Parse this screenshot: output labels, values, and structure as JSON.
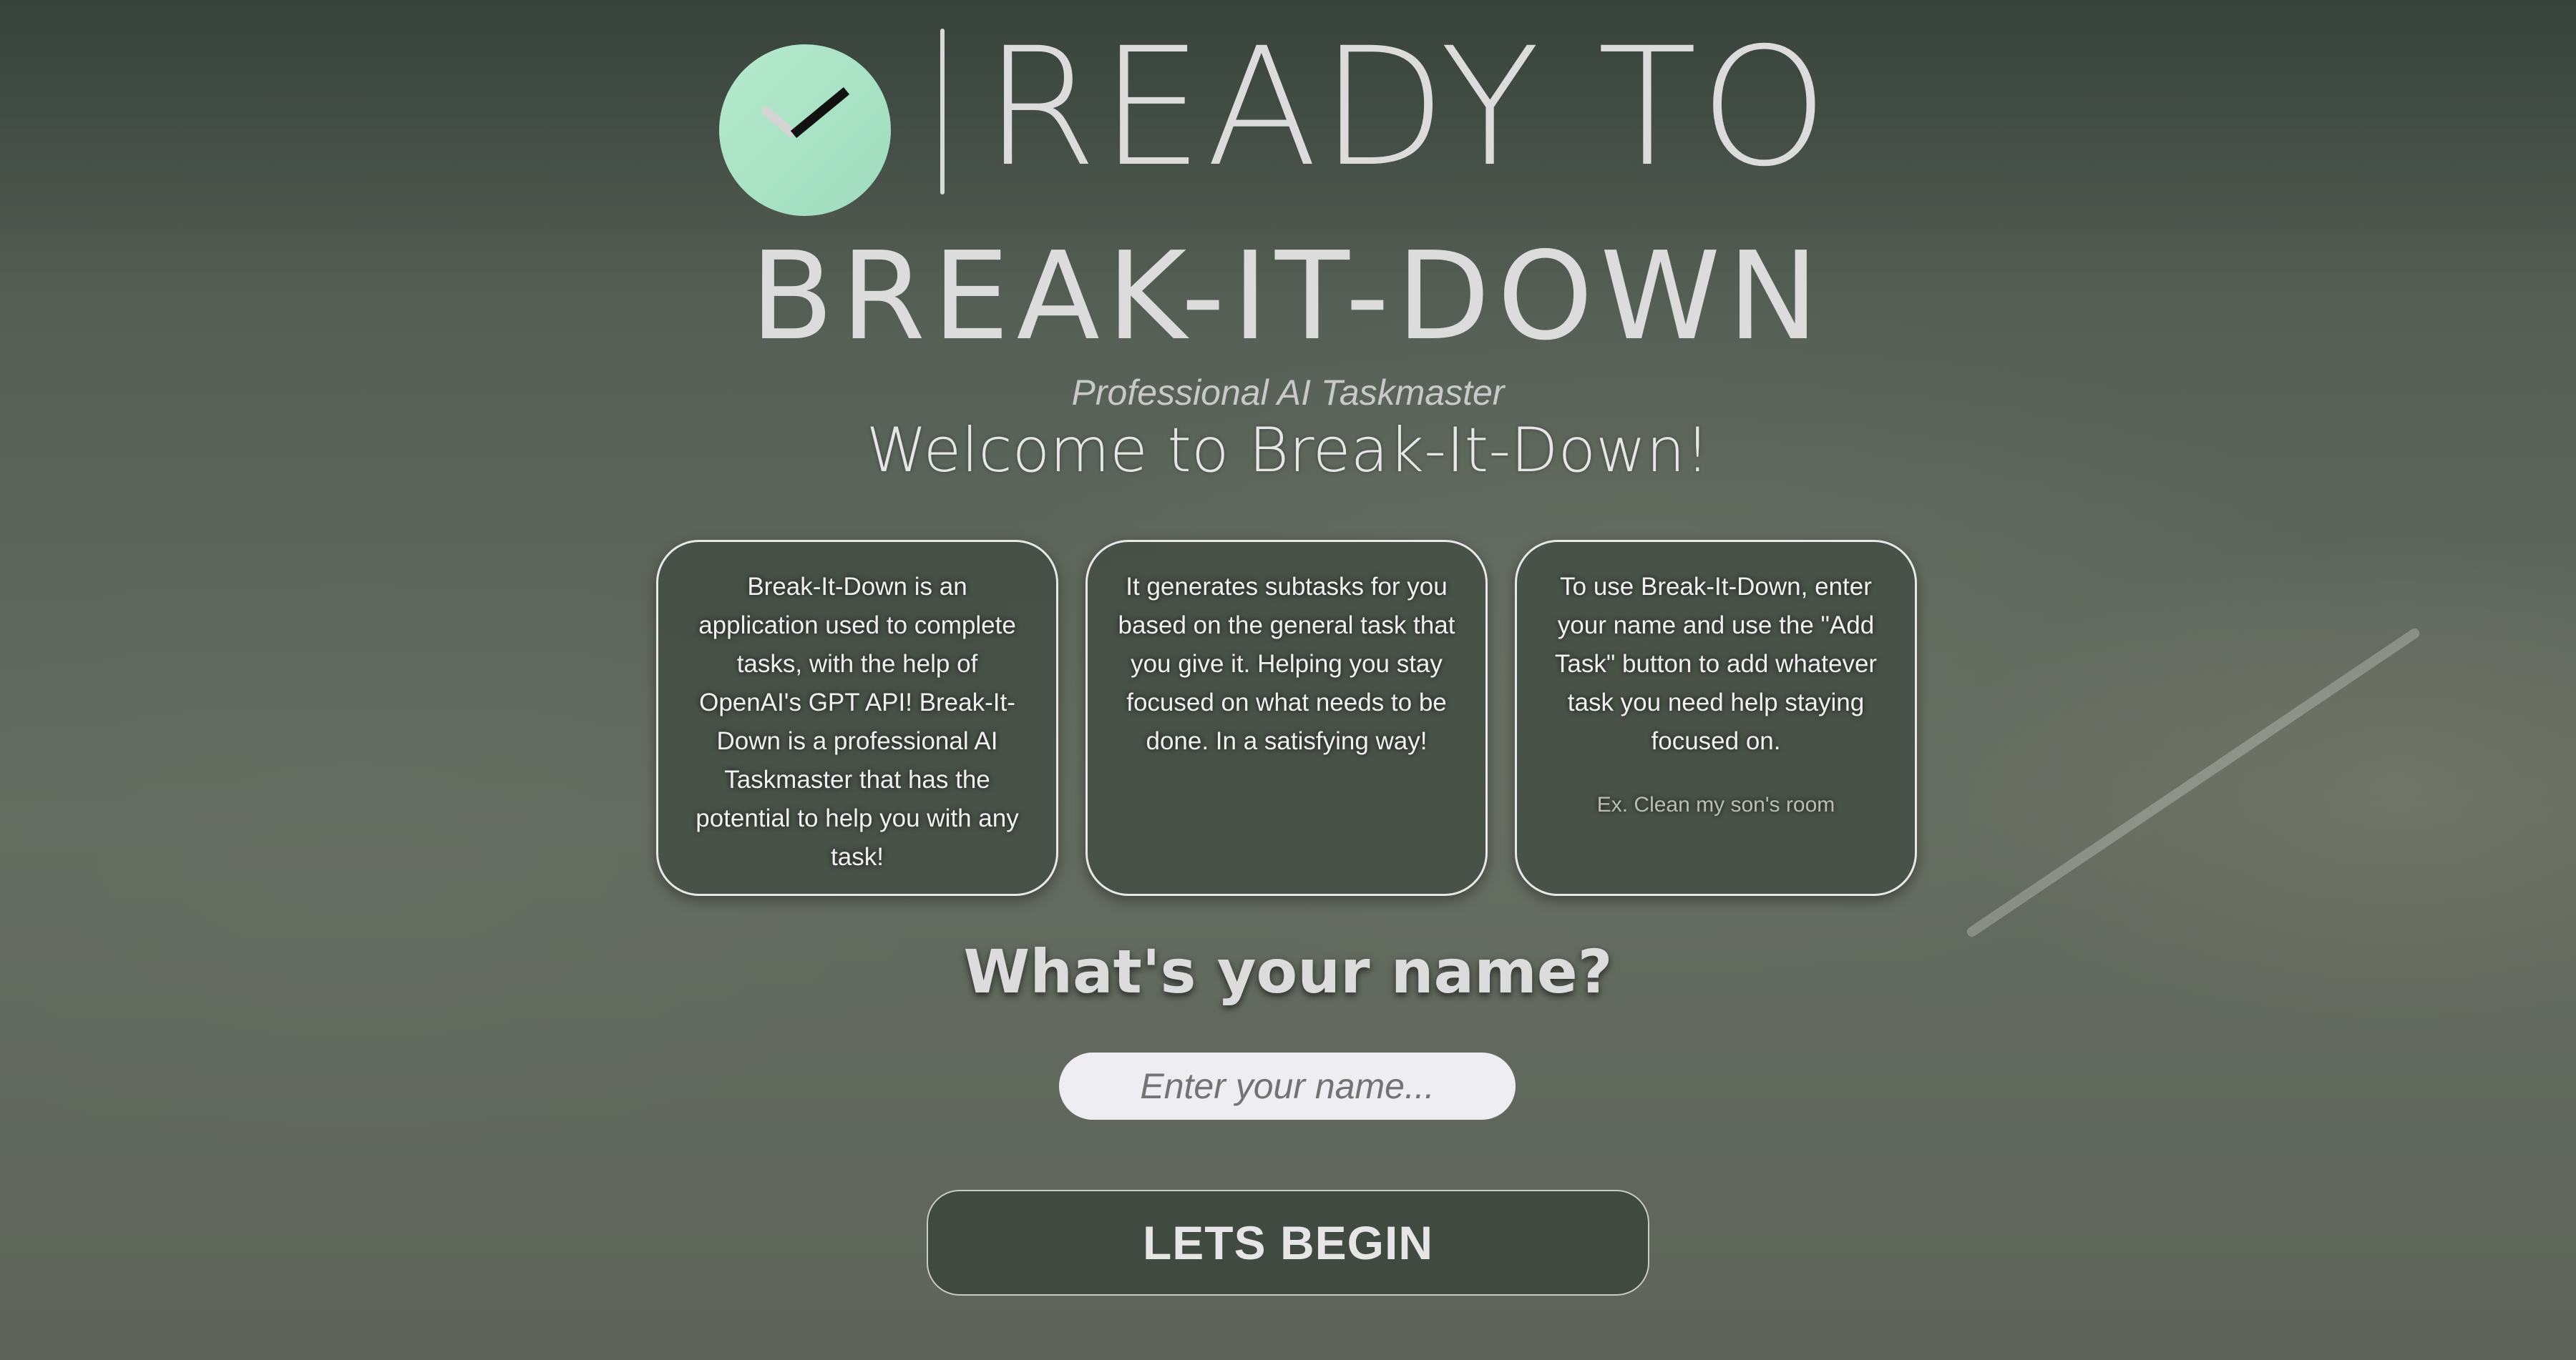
{
  "brand": {
    "logo_icon": "check-clock-icon",
    "top_line": "READY TO",
    "name": "BREAK-IT-DOWN",
    "tagline": "Professional AI Taskmaster"
  },
  "welcome": {
    "heading": "Welcome to Break-It-Down!"
  },
  "cards": [
    {
      "text": "Break-It-Down is an application used to complete tasks, with the help of OpenAI's GPT API! Break-It-Down is a professional AI Taskmaster that has the potential to help you with any task!"
    },
    {
      "text": "It generates subtasks for you based on the general task that you give it. Helping you stay focused on what needs to be done. In a satisfying way!"
    },
    {
      "text": "To use Break-It-Down, enter your name and use the \"Add Task\" button to add whatever task you need help staying focused on.",
      "example": "Ex. Clean my son's room"
    }
  ],
  "name_form": {
    "question": "What's your name?",
    "placeholder": "Enter your name...",
    "value": ""
  },
  "actions": {
    "begin_label": "LETS BEGIN"
  },
  "colors": {
    "logo_accent": "#b5e9cd",
    "card_background": "#3e483e",
    "button_background": "#414a41",
    "input_background": "#ededf2"
  }
}
